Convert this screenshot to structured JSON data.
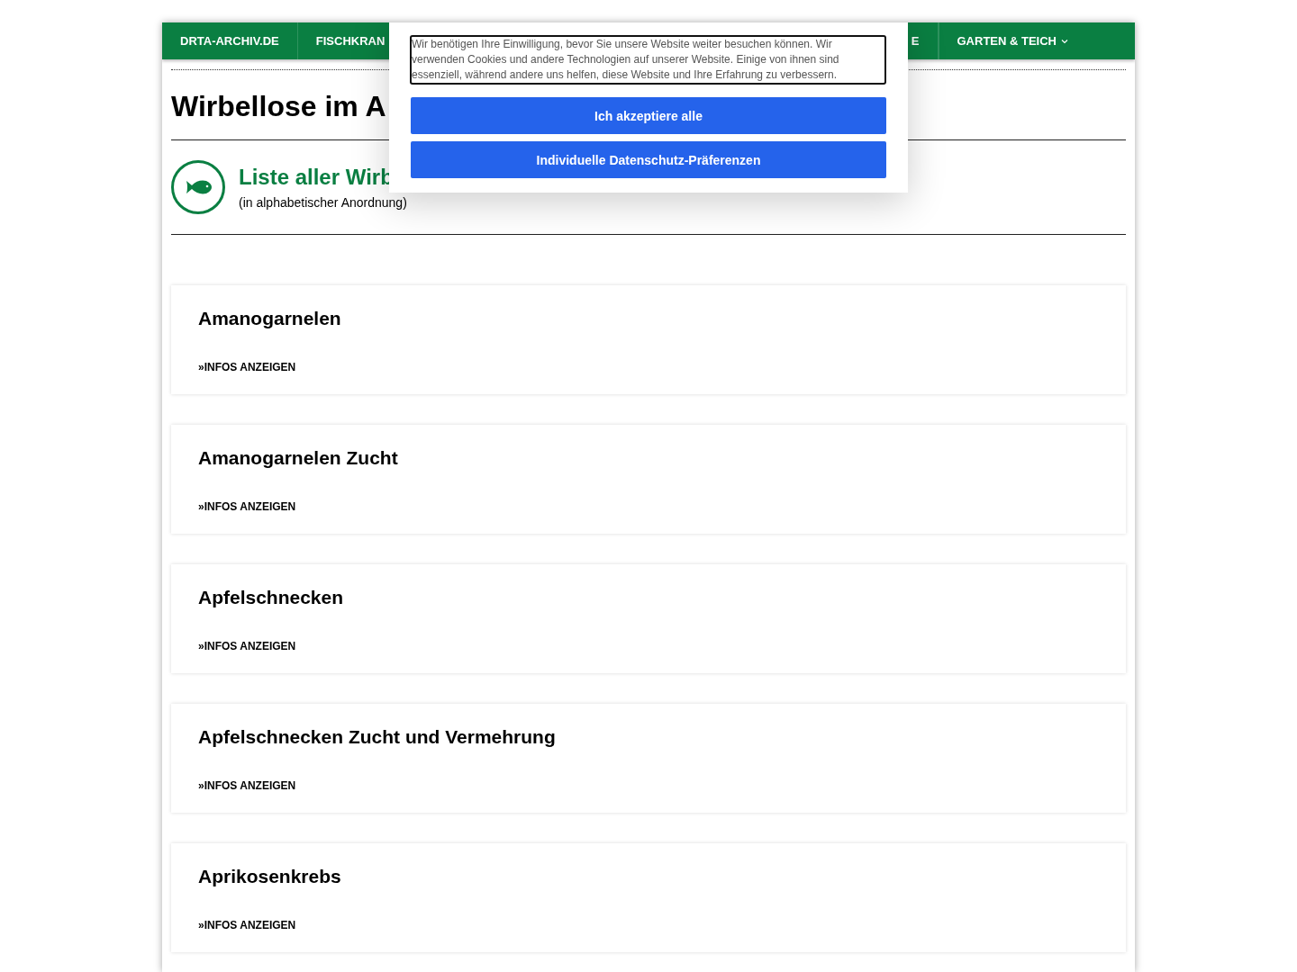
{
  "nav": {
    "items": [
      {
        "label": "DRTA-ARCHIV.DE",
        "dropdown": false
      },
      {
        "label": "FISCHKRAN",
        "dropdown": false
      },
      {
        "label": "E",
        "dropdown": false
      },
      {
        "label": "GARTEN & TEICH",
        "dropdown": true
      }
    ]
  },
  "page": {
    "title": "Wirbellose im A",
    "list_heading": "Liste aller Wirb",
    "list_subtitle": "(in alphabetischer Anordnung)"
  },
  "cards": [
    {
      "title": "Amanogarnelen",
      "link": "»INFOS ANZEIGEN"
    },
    {
      "title": "Amanogarnelen Zucht",
      "link": "»INFOS ANZEIGEN"
    },
    {
      "title": "Apfelschnecken",
      "link": "»INFOS ANZEIGEN"
    },
    {
      "title": "Apfelschnecken Zucht und Vermehrung",
      "link": "»INFOS ANZEIGEN"
    },
    {
      "title": "Aprikosenkrebs",
      "link": "»INFOS ANZEIGEN"
    }
  ],
  "consent": {
    "text": "Wir benötigen Ihre Einwilligung, bevor Sie unsere Website weiter besuchen können. Wir verwenden Cookies und andere Technologien auf unserer Website. Einige von ihnen sind essenziell, während andere uns helfen, diese Website und Ihre Erfahrung zu verbessern.",
    "buttons": [
      "Ich akzeptiere alle",
      "Individuelle Datenschutz-Präferenzen"
    ]
  }
}
